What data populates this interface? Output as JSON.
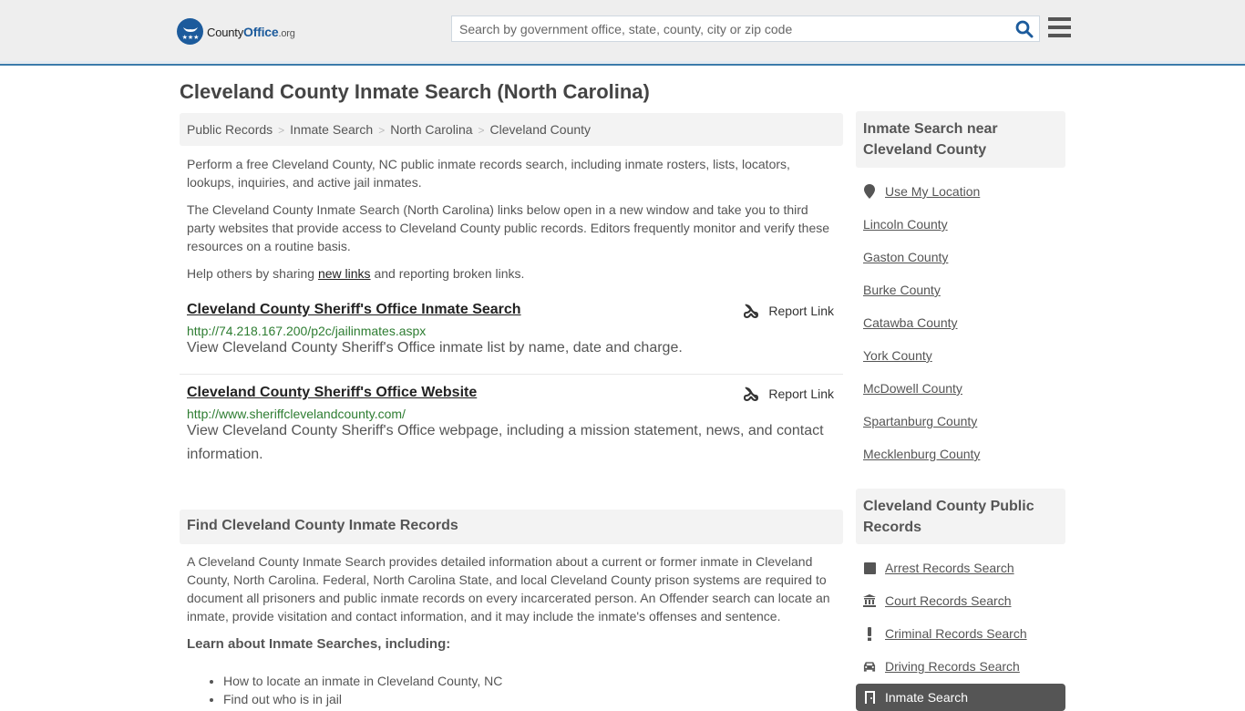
{
  "header": {
    "logo": {
      "name": "County",
      "accent": "Office",
      "suffix": ".org",
      "brand_color": "#1c5b9c"
    },
    "search": {
      "placeholder": "Search by government office, state, county, city or zip code",
      "value": ""
    },
    "icons": {
      "search": "search-icon",
      "menu": "hamburger-menu-icon"
    }
  },
  "page": {
    "title": "Cleveland County Inmate Search (North Carolina)",
    "breadcrumb": [
      "Public Records",
      "Inmate Search",
      "North Carolina",
      "Cleveland County"
    ],
    "intro": {
      "p1": "Perform a free Cleveland County, NC public inmate records search, including inmate rosters, lists, locators, lookups, inquiries, and active jail inmates.",
      "p2": "The Cleveland County Inmate Search (North Carolina) links below open in a new window and take you to third party websites that provide access to Cleveland County public records. Editors frequently monitor and verify these resources on a routine basis.",
      "p3_before": "Help others by sharing ",
      "p3_link": "new links",
      "p3_after": " and reporting broken links."
    },
    "results": [
      {
        "title": "Cleveland County Sheriff's Office Inmate Search",
        "url": "http://74.218.167.200/p2c/jailinmates.aspx",
        "description": "View Cleveland County Sheriff's Office inmate list by name, date and charge.",
        "report_label": "Report Link"
      },
      {
        "title": "Cleveland County Sheriff's Office Website",
        "url": "http://www.sheriffclevelandcounty.com/",
        "description": "View Cleveland County Sheriff's Office webpage, including a mission statement, news, and contact information.",
        "report_label": "Report Link"
      }
    ],
    "find_section": {
      "heading": "Find Cleveland County Inmate Records",
      "body": "A Cleveland County Inmate Search provides detailed information about a current or former inmate in Cleveland County, North Carolina. Federal, North Carolina State, and local Cleveland County prison systems are required to document all prisoners and public inmate records on every incarcerated person. An Offender search can locate an inmate, provide visitation and contact information, and it may include the inmate's offenses and sentence.",
      "learn_heading": "Learn about Inmate Searches, including:",
      "bullets": [
        "How to locate an inmate in Cleveland County, NC",
        "Find out who is in jail"
      ]
    }
  },
  "sidebar": {
    "nearby": {
      "heading": "Inmate Search near Cleveland County",
      "use_location": "Use My Location",
      "counties": [
        "Lincoln County",
        "Gaston County",
        "Burke County",
        "Catawba County",
        "York County",
        "McDowell County",
        "Spartanburg County",
        "Mecklenburg County"
      ]
    },
    "public_records": {
      "heading": "Cleveland County Public Records",
      "items": [
        {
          "label": "Arrest Records Search",
          "icon": "square-icon"
        },
        {
          "label": "Court Records Search",
          "icon": "courthouse-icon"
        },
        {
          "label": "Criminal Records Search",
          "icon": "exclamation-icon"
        },
        {
          "label": "Driving Records Search",
          "icon": "car-icon"
        },
        {
          "label": "Inmate Search",
          "icon": "door-icon",
          "active": true
        }
      ]
    }
  }
}
